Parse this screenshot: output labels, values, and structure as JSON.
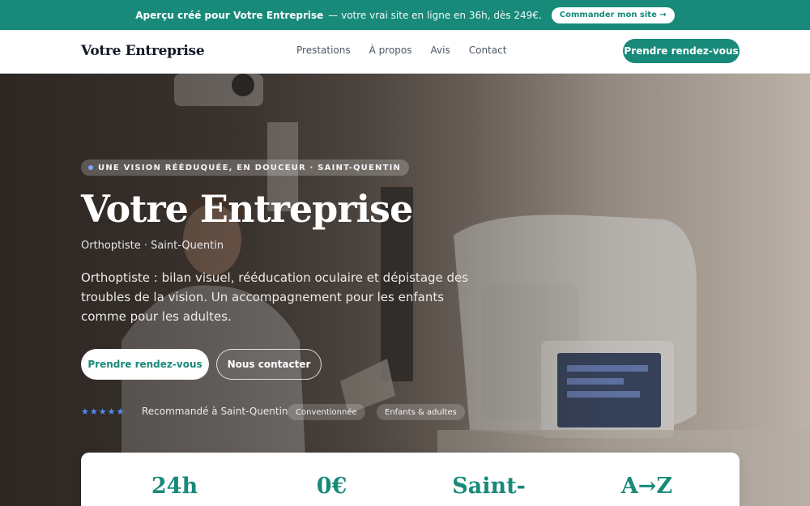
{
  "promo": {
    "lead": "Aperçu créé pour Votre Entreprise",
    "rest": "— votre vrai site en ligne en 36h, dès 249€.",
    "button": "Commander mon site →"
  },
  "nav": {
    "brand": "Votre Entreprise",
    "items": [
      "Prestations",
      "À propos",
      "Avis",
      "Contact"
    ],
    "cta": "Prendre rendez-vous"
  },
  "hero": {
    "badge": "UNE VISION RÉÉDUQUÉE, EN DOUCEUR · SAINT-QUENTIN",
    "title": "Votre Entreprise",
    "subtitle": "Orthoptiste · Saint-Quentin",
    "description": "Orthoptiste : bilan visuel, rééducation oculaire et dépistage des troubles de la vision. Un accompagnement pour les enfants comme pour les adultes.",
    "primary_button": "Prendre rendez-vous",
    "secondary_button": "Nous contacter",
    "stars": "★★★★★",
    "recommendation": "Recommandé à Saint-Quentin",
    "chips": [
      "Conventionnée",
      "Enfants & adultes"
    ]
  },
  "stats": [
    "24h",
    "0€",
    "Saint-",
    "A→Z"
  ],
  "colors": {
    "accent": "#188a7a",
    "star": "#4f8df7"
  }
}
